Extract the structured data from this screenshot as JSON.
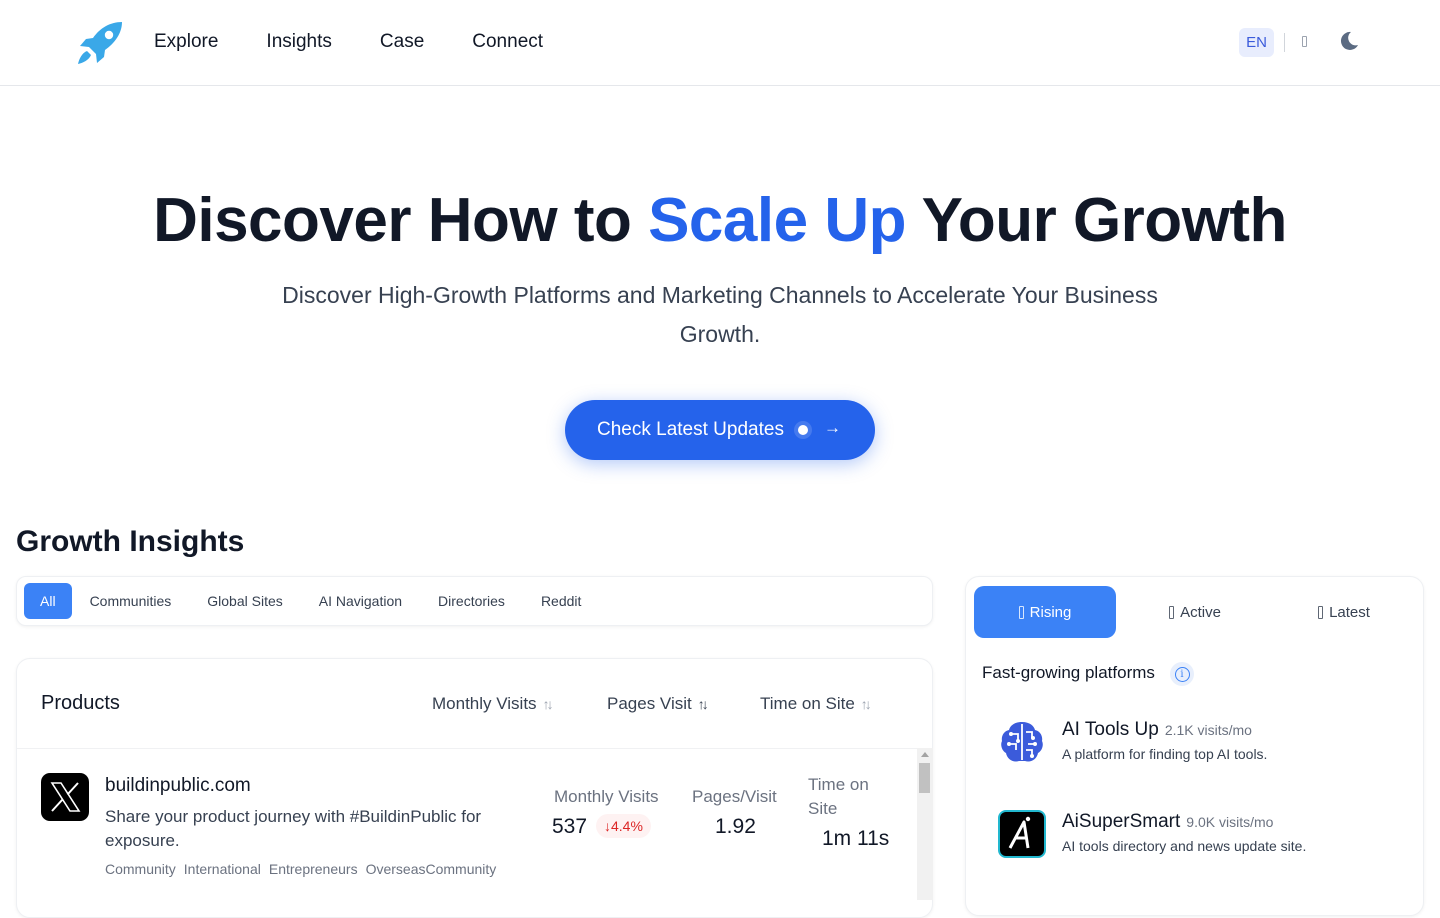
{
  "header": {
    "logo_icon": "rocket-icon",
    "nav": [
      "Explore",
      "Insights",
      "Case",
      "Connect"
    ],
    "lang": "EN",
    "theme_icon": "moon-icon"
  },
  "hero": {
    "title_pre": "Discover How to ",
    "title_accent": "Scale Up",
    "title_post": " Your Growth",
    "subtitle": "Discover High-Growth Platforms and Marketing Channels to Accelerate Your Business Growth.",
    "cta_label": "Check Latest Updates",
    "cta_icon": "arrow-right-icon"
  },
  "insights": {
    "title": "Growth Insights",
    "filters": [
      {
        "label": "All",
        "active": true
      },
      {
        "label": "Communities"
      },
      {
        "label": "Global Sites"
      },
      {
        "label": "AI Navigation"
      },
      {
        "label": "Directories"
      },
      {
        "label": "Reddit"
      }
    ],
    "products": {
      "title": "Products",
      "columns": [
        "Monthly Visits",
        "Pages Visit",
        "Time on Site"
      ],
      "rows": [
        {
          "name": "buildinpublic.com",
          "logo": "x-logo-icon",
          "description": "Share your product journey with #BuildinPublic for exposure.",
          "tags": [
            "Community",
            "International",
            "Entrepreneurs",
            "OverseasCommunity"
          ],
          "monthly_visits_label": "Monthly Visits",
          "monthly_visits": "537",
          "delta": "↓4.4%",
          "pages_label": "Pages/Visit",
          "pages": "1.92",
          "time_label": "Time on Site",
          "time": "1m 11s"
        }
      ]
    }
  },
  "side": {
    "tabs": [
      {
        "label": "Rising",
        "active": true
      },
      {
        "label": "Active"
      },
      {
        "label": "Latest"
      }
    ],
    "heading": "Fast-growing platforms",
    "platforms": [
      {
        "name": "AI Tools Up",
        "visits": "2.1K visits/mo",
        "description": "A platform for finding top AI tools.",
        "logo": "brain-circuit-icon"
      },
      {
        "name": "AiSuperSmart",
        "visits": "9.0K visits/mo",
        "description": "AI tools directory and news update site.",
        "logo": "aisupersmart-logo-icon"
      }
    ]
  },
  "colors": {
    "accent": "#2563eb",
    "tab_active": "#3b82f6",
    "negative": "#dc2626"
  }
}
